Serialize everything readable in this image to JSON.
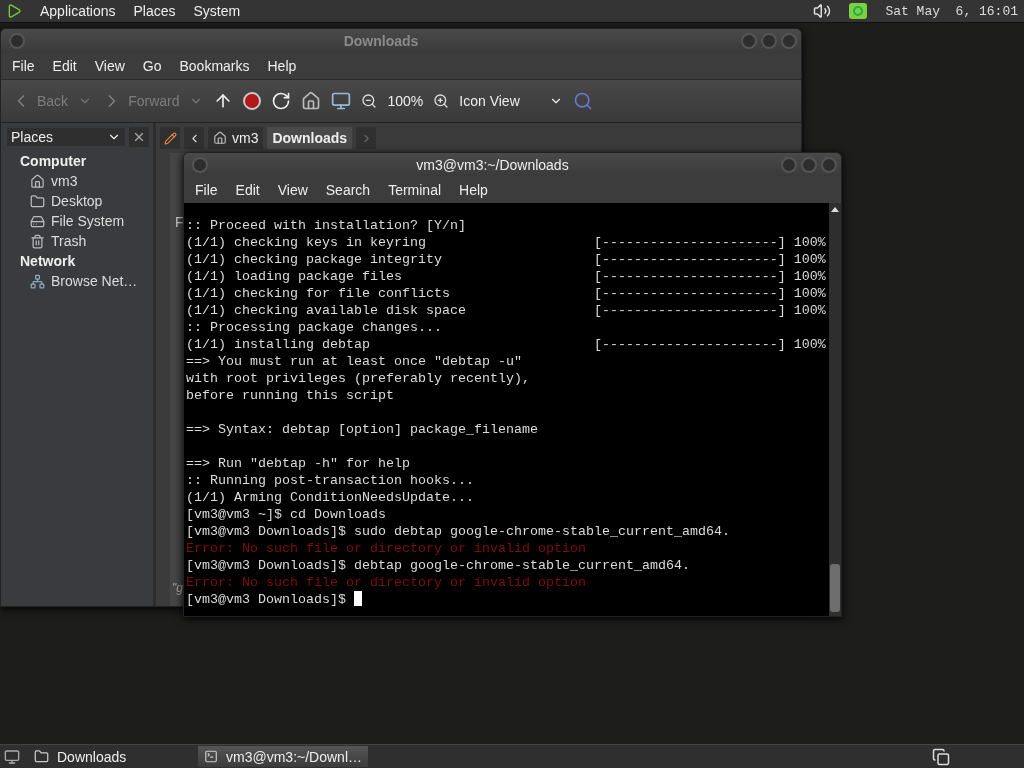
{
  "top_panel": {
    "menus": [
      "Applications",
      "Places",
      "System"
    ],
    "clock": "Sat May  6, 16:01"
  },
  "file_manager": {
    "title": "Downloads",
    "menu": [
      "File",
      "Edit",
      "View",
      "Go",
      "Bookmarks",
      "Help"
    ],
    "toolbar": {
      "back": {
        "label": "Back",
        "disabled": true
      },
      "forward": {
        "label": "Forward",
        "disabled": true
      },
      "zoom": "100%",
      "view": "Icon View"
    },
    "sidebar": {
      "title": "Places",
      "sections": [
        {
          "heading": "Computer",
          "items": [
            {
              "label": "vm3",
              "kind": "home"
            },
            {
              "label": "Desktop",
              "kind": "desktop"
            },
            {
              "label": "File System",
              "kind": "drive"
            },
            {
              "label": "Trash",
              "kind": "trash"
            }
          ]
        },
        {
          "heading": "Network",
          "items": [
            {
              "label": "Browse Net…",
              "kind": "network"
            }
          ]
        }
      ]
    },
    "path": [
      {
        "label": "vm3",
        "selected": false
      },
      {
        "label": "Downloads",
        "selected": true
      }
    ],
    "content_text": "F",
    "status_text": "\"g"
  },
  "terminal": {
    "title": "vm3@vm3:~/Downloads",
    "menu": [
      "File",
      "Edit",
      "View",
      "Search",
      "Terminal",
      "Help"
    ],
    "cursor": true,
    "lines": [
      {
        "text": ":: Proceed with installation? [Y/n]",
        "kind": "normal"
      },
      {
        "text": "(1/1) checking keys in keyring",
        "progress": "[----------------------] 100%",
        "kind": "normal"
      },
      {
        "text": "(1/1) checking package integrity",
        "progress": "[----------------------] 100%",
        "kind": "normal"
      },
      {
        "text": "(1/1) loading package files",
        "progress": "[----------------------] 100%",
        "kind": "normal"
      },
      {
        "text": "(1/1) checking for file conflicts",
        "progress": "[----------------------] 100%",
        "kind": "normal"
      },
      {
        "text": "(1/1) checking available disk space",
        "progress": "[----------------------] 100%",
        "kind": "normal"
      },
      {
        "text": ":: Processing package changes...",
        "kind": "normal"
      },
      {
        "text": "(1/1) installing debtap",
        "progress": "[----------------------] 100%",
        "kind": "normal"
      },
      {
        "text": "==> You must run at least once \"debtap -u\"",
        "kind": "normal"
      },
      {
        "text": "with root privileges (preferably recently),",
        "kind": "normal"
      },
      {
        "text": "before running this script",
        "kind": "normal"
      },
      {
        "kind": "blank"
      },
      {
        "text": "==> Syntax: debtap [option] package_filename",
        "kind": "normal"
      },
      {
        "kind": "blank"
      },
      {
        "text": "==> Run \"debtap -h\" for help",
        "kind": "normal"
      },
      {
        "text": ":: Running post-transaction hooks...",
        "kind": "normal"
      },
      {
        "text": "(1/1) Arming ConditionNeedsUpdate...",
        "kind": "normal"
      },
      {
        "text": "[vm3@vm3 ~]$ cd Downloads",
        "kind": "normal"
      },
      {
        "text": "[vm3@vm3 Downloads]$ sudo debtap google-chrome-stable_current_amd64.",
        "kind": "normal"
      },
      {
        "text": "Error: No such file or directory or invalid option",
        "kind": "error"
      },
      {
        "text": "[vm3@vm3 Downloads]$ debtap google-chrome-stable_current_amd64.",
        "kind": "normal"
      },
      {
        "text": "Error: No such file or directory or invalid option",
        "kind": "error"
      },
      {
        "text": "[vm3@vm3 Downloads]$",
        "kind": "prompt"
      }
    ]
  },
  "taskbar": {
    "tasks": [
      {
        "label": "Downloads",
        "selected": false
      },
      {
        "label": "vm3@vm3:~/Downl…",
        "selected": true
      }
    ]
  }
}
